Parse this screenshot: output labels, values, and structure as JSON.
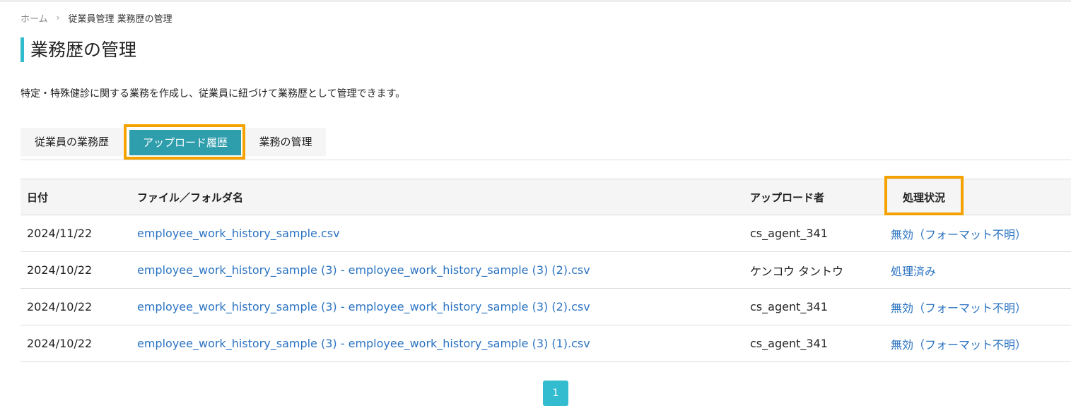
{
  "breadcrumb": {
    "home": "ホーム",
    "separator": "›",
    "current": "従業員管理 業務歴の管理"
  },
  "page": {
    "title": "業務歴の管理",
    "description": "特定・特殊健診に関する業務を作成し、従業員に紐づけて業務歴として管理できます。"
  },
  "tabs": [
    {
      "label": "従業員の業務歴",
      "active": false
    },
    {
      "label": "アップロード履歴",
      "active": true
    },
    {
      "label": "業務の管理",
      "active": false
    }
  ],
  "table": {
    "headers": {
      "date": "日付",
      "file": "ファイル／フォルダ名",
      "uploader": "アップロード者",
      "status": "処理状況"
    },
    "rows": [
      {
        "date": "2024/11/22",
        "file": "employee_work_history_sample.csv",
        "uploader": "cs_agent_341",
        "status": "無効（フォーマット不明）"
      },
      {
        "date": "2024/10/22",
        "file": "employee_work_history_sample (3) - employee_work_history_sample (3) (2).csv",
        "uploader": "ケンコウ タントウ",
        "status": "処理済み"
      },
      {
        "date": "2024/10/22",
        "file": "employee_work_history_sample (3) - employee_work_history_sample (3) (2).csv",
        "uploader": "cs_agent_341",
        "status": "無効（フォーマット不明）"
      },
      {
        "date": "2024/10/22",
        "file": "employee_work_history_sample (3) - employee_work_history_sample (3) (1).csv",
        "uploader": "cs_agent_341",
        "status": "無効（フォーマット不明）"
      }
    ]
  },
  "pagination": {
    "current_page": "1"
  },
  "colors": {
    "accent": "#33bccf",
    "active_tab": "#2f9eac",
    "highlight_outline": "#f5a200",
    "link": "#2b73c2"
  }
}
